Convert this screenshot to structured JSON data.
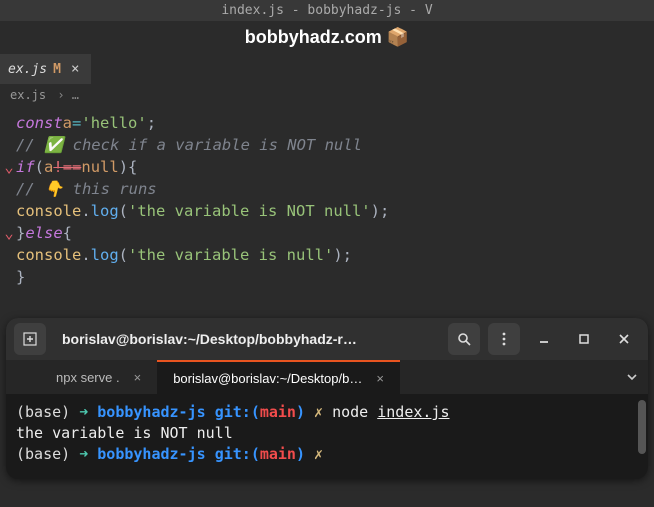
{
  "window": {
    "title": "index.js - bobbyhadz-js - V"
  },
  "banner": {
    "text": "bobbyhadz.com 📦"
  },
  "editorTab": {
    "name": "ex.js",
    "modified": "M",
    "close": "×"
  },
  "breadcrumb": {
    "file": "ex.js",
    "rest": "›  …"
  },
  "code": {
    "l1": {
      "kw": "const",
      "v": "a",
      "op": "=",
      "str": "'hello'",
      "semi": ";"
    },
    "l2": {
      "cmt": "// ✅ check if a variable is NOT null"
    },
    "l3": {
      "kw": "if",
      "lp": "(",
      "v": "a",
      "neq": "!==",
      "nul": "null",
      "rp": ")",
      "br": "{"
    },
    "l4": {
      "cmt": "// 👇 this runs"
    },
    "l5": {
      "obj": "console",
      "dot": ".",
      "fn": "log",
      "lp": "(",
      "str": "'the variable is NOT null'",
      "rp": ")",
      "semi": ";"
    },
    "l6": {
      "rb": "}",
      "kw": "else",
      "lb": "{"
    },
    "l7": {
      "obj": "console",
      "dot": ".",
      "fn": "log",
      "lp": "(",
      "str": "'the variable is null'",
      "rp": ")",
      "semi": ";"
    },
    "l8": {
      "rb": "}"
    }
  },
  "terminal": {
    "title": "borislav@borislav:~/Desktop/bobbyhadz-r…",
    "tabs": {
      "t1": {
        "label": "npx serve .",
        "close": "×"
      },
      "t2": {
        "label": "borislav@borislav:~/Desktop/b…",
        "close": "×"
      }
    },
    "line1": {
      "base": "(base)",
      "arrow": "➜",
      "dir": "bobbyhadz-js",
      "git": "git:",
      "lp": "(",
      "branch": "main",
      "rp": ")",
      "x": "✗",
      "cmd": "node",
      "arg": "index.js"
    },
    "line2": {
      "out": "the variable is NOT null"
    },
    "line3": {
      "base": "(base)",
      "arrow": "➜",
      "dir": "bobbyhadz-js",
      "git": "git:",
      "lp": "(",
      "branch": "main",
      "rp": ")",
      "x": "✗"
    }
  }
}
